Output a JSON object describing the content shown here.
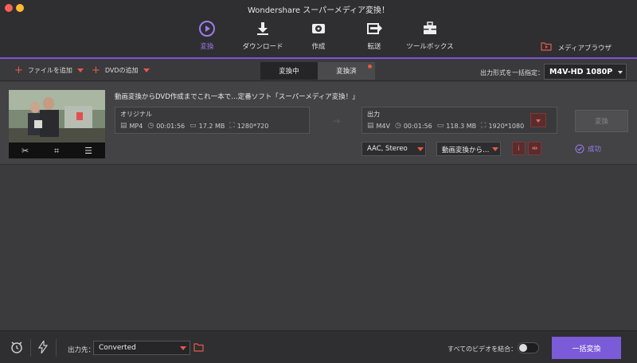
{
  "window": {
    "title": "Wondershare スーパーメディア変換！"
  },
  "tabs": [
    {
      "label": "変換",
      "icon": "convert-icon",
      "active": true
    },
    {
      "label": "ダウンロード",
      "icon": "download-icon",
      "active": false
    },
    {
      "label": "作成",
      "icon": "burn-disc-icon",
      "active": false
    },
    {
      "label": "転送",
      "icon": "transfer-icon",
      "active": false
    },
    {
      "label": "ツールボックス",
      "icon": "toolbox-icon",
      "active": false
    }
  ],
  "media_browser": {
    "label": "メディアブラウザ"
  },
  "subbar": {
    "add_file": "ファイルを追加",
    "add_dvd": "DVDの追加",
    "seg_converting": "変換中",
    "seg_converted": "変換済",
    "format_label": "出力形式を一括指定：",
    "format_value": "M4V-HD 1080P"
  },
  "file": {
    "title": "動画変換からDVD作成までこれ一本で…定番ソフト「スーパーメディア変換！」",
    "original": {
      "label": "オリジナル",
      "format": "MP4",
      "duration": "00:01:56",
      "size": "17.2 MB",
      "resolution": "1280*720"
    },
    "output": {
      "label": "出力",
      "format": "M4V",
      "duration": "00:01:56",
      "size": "118.3 MB",
      "resolution": "1920*1080"
    },
    "audio": "AAC, Stereo",
    "subtitle": "動画変換から…",
    "convert_label": "変換",
    "status": "成功"
  },
  "bottom": {
    "dest_label": "出力先：",
    "dest_value": "Converted",
    "merge_label": "すべてのビデオを結合：",
    "merge_on": false,
    "batch_label": "一括変換"
  },
  "colors": {
    "accent": "#7b5bd8",
    "red": "#e45a4a"
  }
}
